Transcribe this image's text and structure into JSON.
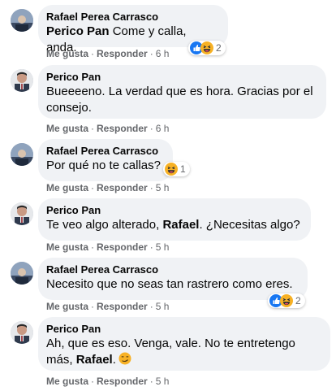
{
  "colors": {
    "bubble": "#f0f2f5",
    "secondary_text": "#65676b",
    "like_blue": "#1877f2",
    "haha_yellow": "#f7b125"
  },
  "actions": {
    "like": "Me gusta",
    "reply": "Responder",
    "dot": "·"
  },
  "comments": [
    {
      "author": "Rafael Perea Carrasco",
      "mention": "Perico Pan",
      "text": " Come y calla, anda.",
      "time": "6 h",
      "reactions": {
        "icons": [
          "like-icon",
          "haha-icon"
        ],
        "count": "2"
      }
    },
    {
      "author": "Perico Pan",
      "line1": "Bueeeeno. La verdad que es hora. Gracias por el",
      "line2": "consejo.",
      "time": "6 h"
    },
    {
      "author": "Rafael Perea Carrasco",
      "text": "Por qué no te callas?",
      "time": "5 h",
      "reactions": {
        "icons": [
          "haha-icon"
        ],
        "count": "1"
      }
    },
    {
      "author": "Perico Pan",
      "text_before": "Te veo algo alterado, ",
      "mention": "Rafael",
      "text_after": ". ¿Necesitas algo?",
      "time": "5 h"
    },
    {
      "author": "Rafael Perea Carrasco",
      "text": "Necesito que no seas tan rastrero como eres.",
      "time": "5 h",
      "reactions": {
        "icons": [
          "like-icon",
          "haha-icon"
        ],
        "count": "2"
      }
    },
    {
      "author": "Perico Pan",
      "line1": "Ah, que es eso. Venga, vale. No te entretengo",
      "line2_before": "más, ",
      "mention": "Rafael",
      "line2_after": ".",
      "emoji": "smirk-emoji",
      "time": "5 h"
    }
  ]
}
